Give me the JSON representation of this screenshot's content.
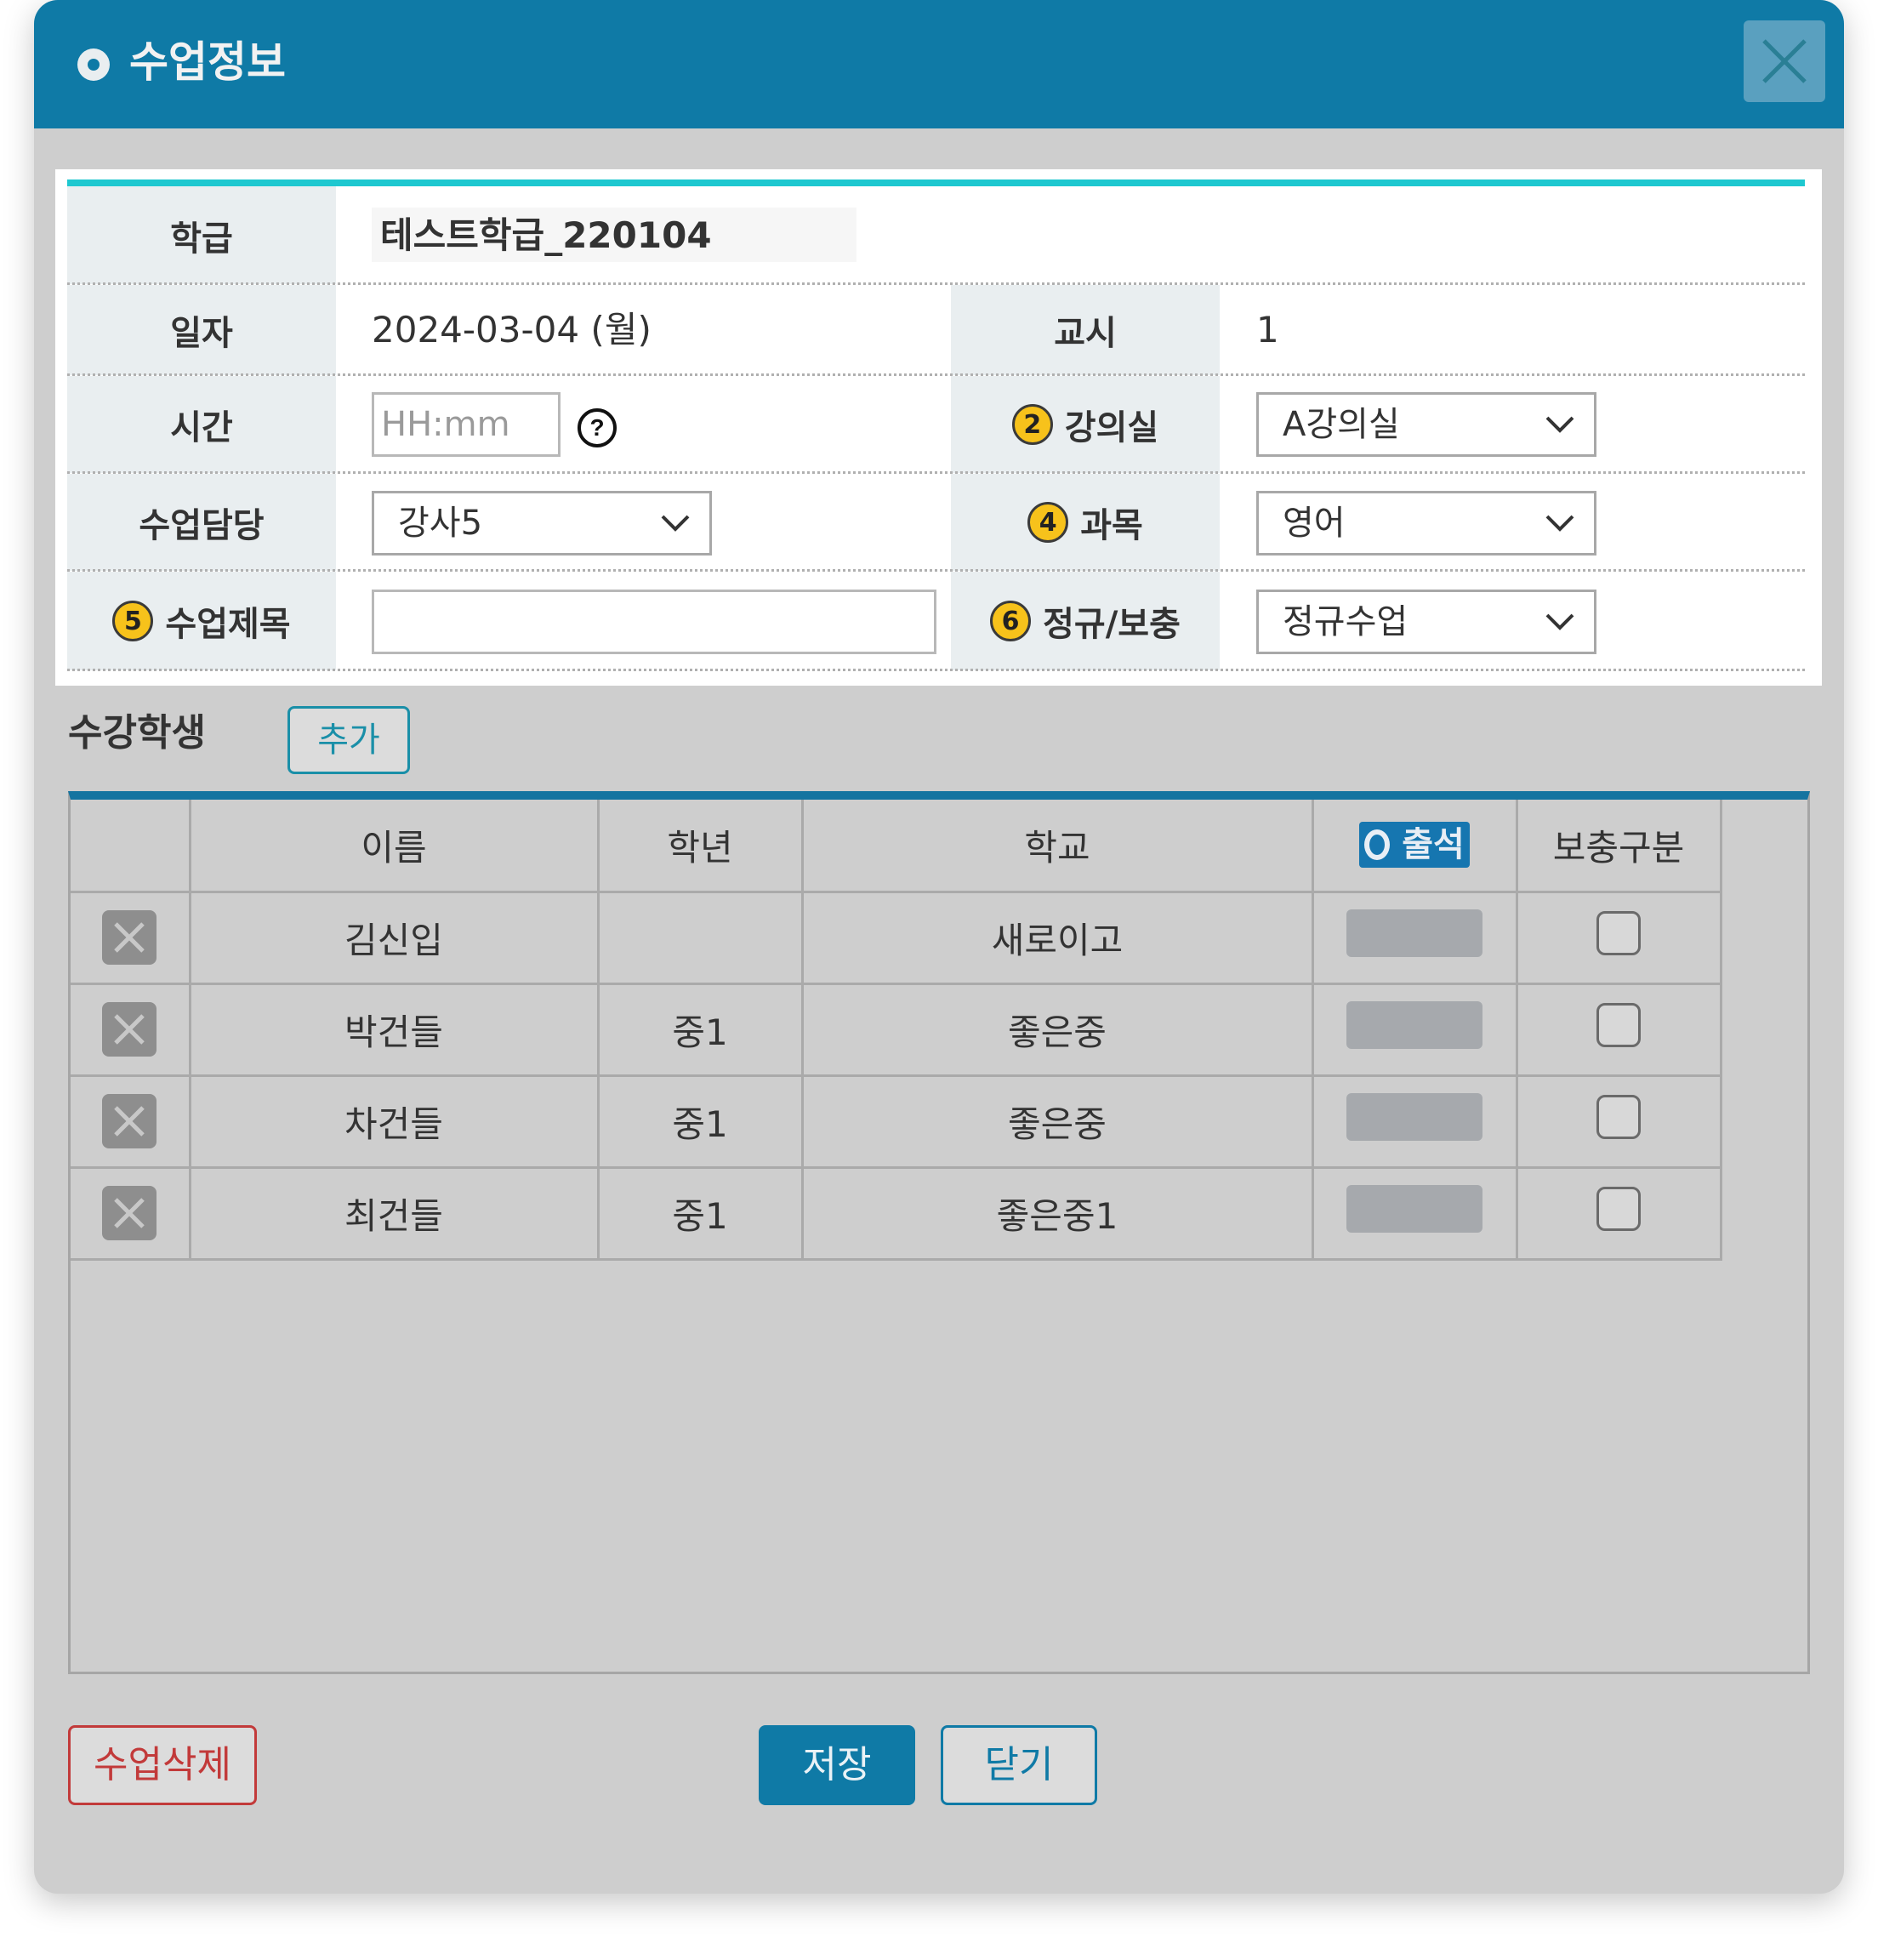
{
  "title": "수업정보",
  "form": {
    "class_label": "학급",
    "class_value": "테스트학급_220104",
    "date_label": "일자",
    "date_value": "2024-03-04 (월)",
    "period_label": "교시",
    "period_value": "1",
    "time_label": "시간",
    "time_placeholder": "HH:mm",
    "help_glyph": "?",
    "room_badge": "2",
    "room_label": "강의실",
    "room_value": "A강의실",
    "teacher_label": "수업담당",
    "teacher_value": "강사5",
    "subject_badge": "4",
    "subject_label": "과목",
    "subject_value": "영어",
    "lesson_title_badge": "5",
    "lesson_title_label": "수업제목",
    "lesson_title_value": "",
    "type_badge": "6",
    "type_label": "정규/보충",
    "type_value": "정규수업"
  },
  "students": {
    "section_title": "수강학생",
    "add_label": "추가",
    "columns": [
      "",
      "이름",
      "학년",
      "학교",
      "출석",
      "보충구분"
    ],
    "rows": [
      {
        "name": "김신입",
        "grade": "",
        "school": "새로이고",
        "supplement_checked": false
      },
      {
        "name": "박건들",
        "grade": "중1",
        "school": "좋은중",
        "supplement_checked": false
      },
      {
        "name": "차건들",
        "grade": "중1",
        "school": "좋은중",
        "supplement_checked": false
      },
      {
        "name": "최건들",
        "grade": "중1",
        "school": "좋은중1",
        "supplement_checked": false
      }
    ]
  },
  "footer": {
    "delete_label": "수업삭제",
    "save_label": "저장",
    "close_label": "닫기"
  },
  "colors": {
    "titlebar": "#0f7aa6",
    "accent_line": "#1ec8d0",
    "badge": "#f7c21b",
    "danger": "#c23a3a"
  },
  "icons": {
    "close": "close-icon",
    "help": "help-circle-icon",
    "dropdown": "chevron-down-icon",
    "row_delete": "delete-row-icon"
  }
}
